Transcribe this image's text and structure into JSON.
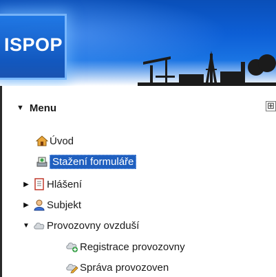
{
  "header": {
    "logo_text": "ISPOP"
  },
  "menu": {
    "title": "Menu",
    "expand_all_label": "⊞",
    "items": [
      {
        "label": "Úvod",
        "icon": "home-icon"
      },
      {
        "label": "Stažení formuláře",
        "icon": "download-form-icon",
        "selected": true
      },
      {
        "label": "Hlášení",
        "icon": "report-icon",
        "toggle": "collapsed"
      },
      {
        "label": "Subjekt",
        "icon": "user-icon",
        "toggle": "collapsed"
      },
      {
        "label": "Provozovny ovzduší",
        "icon": "cloud-icon",
        "toggle": "expanded"
      },
      {
        "label": "Registrace provozovny",
        "icon": "cloud-add-icon"
      },
      {
        "label": "Správa provozoven",
        "icon": "cloud-edit-icon"
      }
    ]
  },
  "colors": {
    "banner": "#0d5fd6",
    "selection": "#1f5fbf"
  }
}
